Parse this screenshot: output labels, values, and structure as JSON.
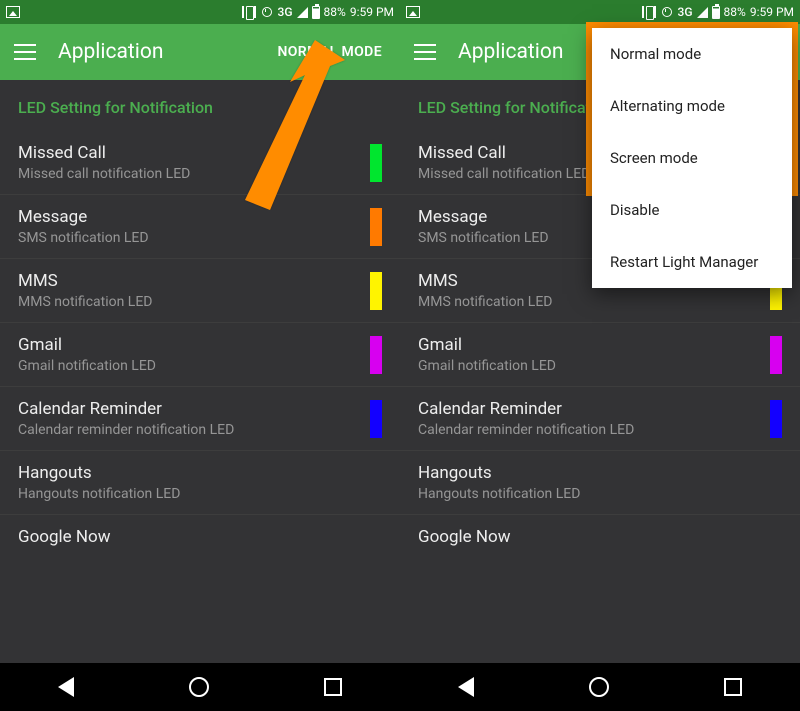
{
  "status": {
    "network": "3G",
    "battery": "88%",
    "time": "9:59 PM"
  },
  "appbar": {
    "title": "Application",
    "mode": "NORMAL MODE"
  },
  "section_header": "LED Setting for Notification",
  "items": [
    {
      "title": "Missed Call",
      "sub": "Missed call notification LED",
      "color": "#00e62e"
    },
    {
      "title": "Message",
      "sub": "SMS notification LED",
      "color": "#ff7a00"
    },
    {
      "title": "MMS",
      "sub": "MMS notification LED",
      "color": "#fff400"
    },
    {
      "title": "Gmail",
      "sub": "Gmail notification LED",
      "color": "#d700f0"
    },
    {
      "title": "Calendar Reminder",
      "sub": "Calendar reminder notification LED",
      "color": "#1300ff"
    },
    {
      "title": "Hangouts",
      "sub": "Hangouts notification LED",
      "color": ""
    },
    {
      "title": "Google Now",
      "sub": "",
      "color": ""
    }
  ],
  "menu": {
    "items": [
      "Normal mode",
      "Alternating mode",
      "Screen mode",
      "Disable",
      "Restart Light Manager"
    ]
  },
  "annotation": {
    "arrow_color": "#ff8c00"
  }
}
